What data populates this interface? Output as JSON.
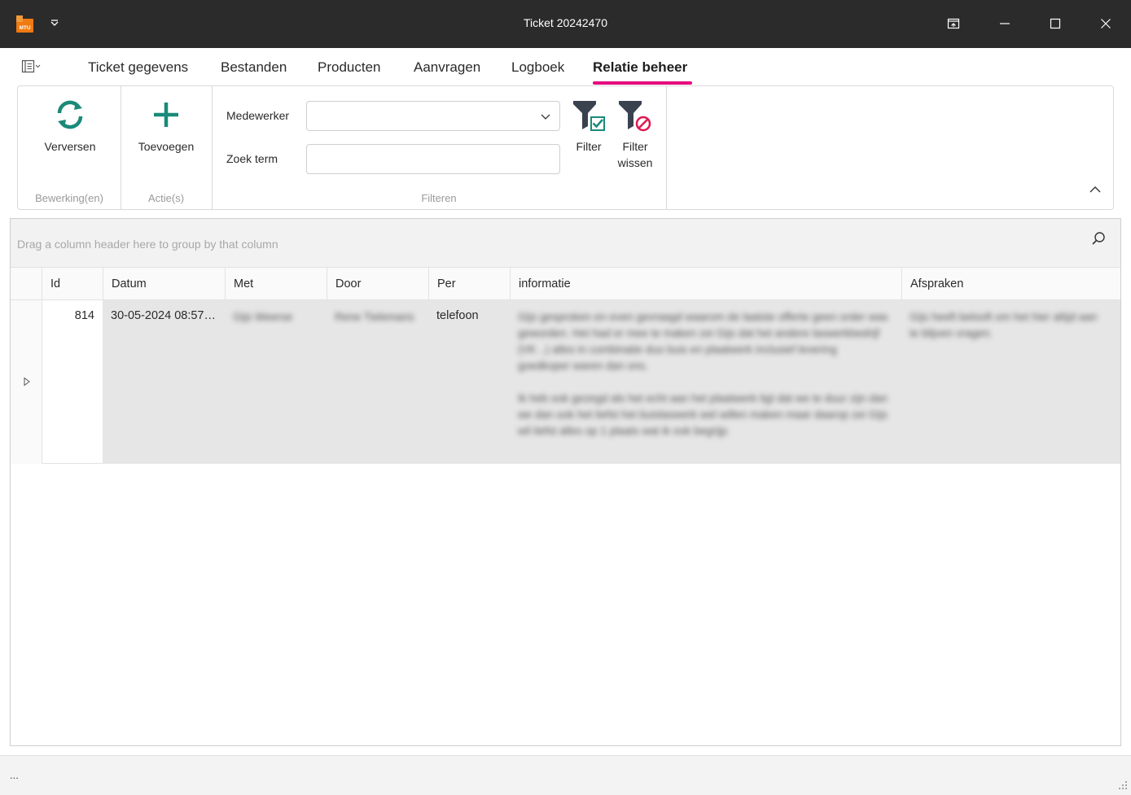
{
  "window": {
    "title": "Ticket 20242470",
    "logo_text": "MTU"
  },
  "tabs": [
    {
      "label": "Ticket gegevens"
    },
    {
      "label": "Bestanden"
    },
    {
      "label": "Producten"
    },
    {
      "label": "Aanvragen"
    },
    {
      "label": "Logboek"
    },
    {
      "label": "Relatie beheer",
      "active": true
    }
  ],
  "ribbon": {
    "refresh_label": "Verversen",
    "add_label": "Toevoegen",
    "group_edit": "Bewerking(en)",
    "group_actions": "Actie(s)",
    "group_filter": "Filteren",
    "employee_label": "Medewerker",
    "employee_value": "",
    "search_label": "Zoek term",
    "search_value": "",
    "filter_label": "Filter",
    "clear_filter_label_1": "Filter",
    "clear_filter_label_2": "wissen"
  },
  "grid": {
    "group_hint": "Drag a column header here to group by that column",
    "columns": [
      "Id",
      "Datum",
      "Met",
      "Door",
      "Per",
      "informatie",
      "Afspraken"
    ],
    "rows": [
      {
        "id": "814",
        "datum": "30-05-2024 08:57:...",
        "met": "Gijs Weerse",
        "door": "Rene Tielemans",
        "per": "telefoon",
        "informatie_1": "Gijs gesproken en even gevraagd waarom de laatste offerte geen order was geworden. Het had er mee te maken zei Gijs dat het andere laswerkbedrijf (VK ..) alles in combinatie duo buis en plaatwerk inclusief levering goedkoper waren dan ons.",
        "informatie_2": "Ik heb ook gezegd als het echt aan het plaatwerk ligt dat we te duur zijn dan we dan ook het liefst het buislaswerk wel willen maken maar daarop zei Gijs wil liefst alles op 1 plaats wat ik ook begrijp.",
        "afspraken": "Gijs heeft belooft om het hier altijd aan te blijven vragen."
      }
    ]
  },
  "colors": {
    "titlebar": "#2b2b2b",
    "accent_tab": "#e6007e",
    "icon_teal": "#1a8a7a",
    "icon_dark": "#3a4250",
    "clear_red": "#e0184f"
  },
  "status": {
    "text": "..."
  }
}
